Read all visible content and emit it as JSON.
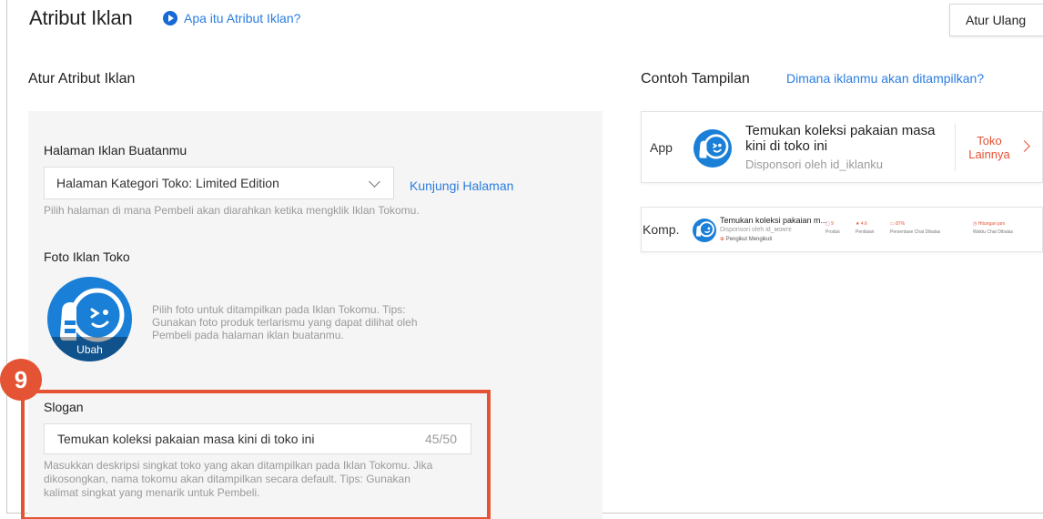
{
  "header": {
    "title": "Atribut Iklan",
    "help_link": "Apa itu Atribut Iklan?",
    "reset_button": "Atur Ulang"
  },
  "form": {
    "section_title": "Atur Atribut Iklan",
    "landing_page": {
      "label": "Halaman Iklan Buatanmu",
      "selected": "Halaman Kategori Toko: Limited Edition",
      "visit_link": "Kunjungi Halaman",
      "hint": "Pilih halaman di mana Pembeli akan diarahkan ketika mengklik Iklan Tokomu."
    },
    "photo": {
      "label": "Foto Iklan Toko",
      "change_label": "Ubah",
      "hint_lines": [
        "Pilih foto untuk ditampilkan pada Iklan Tokomu. Tips:",
        "Gunakan foto produk terlarismu yang dapat dilihat oleh",
        "Pembeli pada halaman iklan buatanmu."
      ]
    },
    "slogan": {
      "step_number": "9",
      "label": "Slogan",
      "value": "Temukan koleksi pakaian masa kini di toko ini",
      "counter": "45/50",
      "hint_lines": [
        "Masukkan deskripsi singkat toko yang akan ditampilkan pada Iklan Tokomu. Jika",
        "dikosongkan, nama tokomu akan ditampilkan secara default. Tips: Gunakan",
        "kalimat singkat yang menarik untuk Pembeli."
      ]
    }
  },
  "preview": {
    "title": "Contoh Tampilan",
    "where_link": "Dimana iklanmu akan ditampilkan?",
    "app": {
      "label": "App",
      "title_lines": [
        "Temukan koleksi pakaian masa",
        "kini di toko ini"
      ],
      "sponsor": "Disponsori oleh id_iklanku",
      "more_lines": [
        "Toko",
        "Lainnya"
      ]
    },
    "comp": {
      "label": "Komp.",
      "title": "Temukan koleksi pakaian m...",
      "sponsor": "Disponsori oleh id_ᴍᴏɴᴛᴇ",
      "follow": "Pengikut Mengikuti",
      "stats": [
        {
          "value": "9",
          "label": "Produk"
        },
        {
          "value": "4.6",
          "label": "Penilaian"
        },
        {
          "value": "87%",
          "label": "Persentase Chat Dibalas"
        },
        {
          "value": "Hitungan jam",
          "label": "Waktu Chat Dibalas"
        }
      ]
    }
  },
  "colors": {
    "accent_blue": "#2a7de1",
    "highlight_red": "#e45333",
    "avatar_blue": "#1a7fd6"
  }
}
